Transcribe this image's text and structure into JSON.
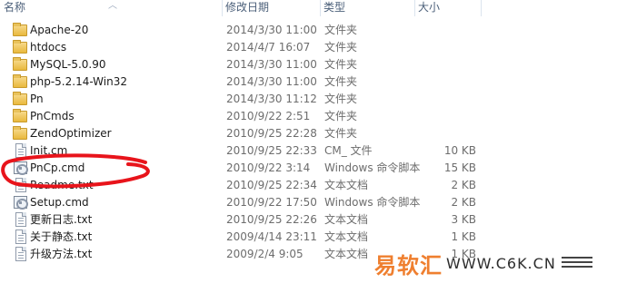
{
  "header": {
    "name": "名称",
    "modified": "修改日期",
    "type": "类型",
    "size": "大小"
  },
  "files": [
    {
      "name": "Apache-20",
      "modified": "2014/3/30 11:00",
      "type": "文件夹",
      "size": "",
      "icon": "folder-icon"
    },
    {
      "name": "htdocs",
      "modified": "2014/4/7 16:07",
      "type": "文件夹",
      "size": "",
      "icon": "folder-icon"
    },
    {
      "name": "MySQL-5.0.90",
      "modified": "2014/3/30 11:00",
      "type": "文件夹",
      "size": "",
      "icon": "folder-icon"
    },
    {
      "name": "php-5.2.14-Win32",
      "modified": "2014/3/30 11:00",
      "type": "文件夹",
      "size": "",
      "icon": "folder-icon"
    },
    {
      "name": "Pn",
      "modified": "2014/3/30 11:12",
      "type": "文件夹",
      "size": "",
      "icon": "folder-icon"
    },
    {
      "name": "PnCmds",
      "modified": "2010/9/22 2:51",
      "type": "文件夹",
      "size": "",
      "icon": "folder-icon"
    },
    {
      "name": "ZendOptimizer",
      "modified": "2010/9/25 22:28",
      "type": "文件夹",
      "size": "",
      "icon": "folder-icon"
    },
    {
      "name": "Init.cm",
      "modified": "2010/9/25 22:33",
      "type": "CM_ 文件",
      "size": "10 KB",
      "icon": "file-icon"
    },
    {
      "name": "PnCp.cmd",
      "modified": "2010/9/22 3:14",
      "type": "Windows 命令脚本",
      "size": "15 KB",
      "icon": "cmd-file-icon"
    },
    {
      "name": "Readme.txt",
      "modified": "2010/9/25 22:34",
      "type": "文本文档",
      "size": "2 KB",
      "icon": "file-icon"
    },
    {
      "name": "Setup.cmd",
      "modified": "2010/9/22 17:50",
      "type": "Windows 命令脚本",
      "size": "2 KB",
      "icon": "cmd-file-icon"
    },
    {
      "name": "更新日志.txt",
      "modified": "2010/9/25 22:26",
      "type": "文本文档",
      "size": "3 KB",
      "icon": "file-icon"
    },
    {
      "name": "关于静态.txt",
      "modified": "2009/4/14 23:11",
      "type": "文本文档",
      "size": "1 KB",
      "icon": "file-icon"
    },
    {
      "name": "升级方法.txt",
      "modified": "2009/2/4 9:05",
      "type": "文本文档",
      "size": "1 KB",
      "icon": "file-icon"
    }
  ],
  "watermark": {
    "brand": "易软汇",
    "site": "WWW.C6K.CN"
  },
  "annotation_color": "#e8141b"
}
